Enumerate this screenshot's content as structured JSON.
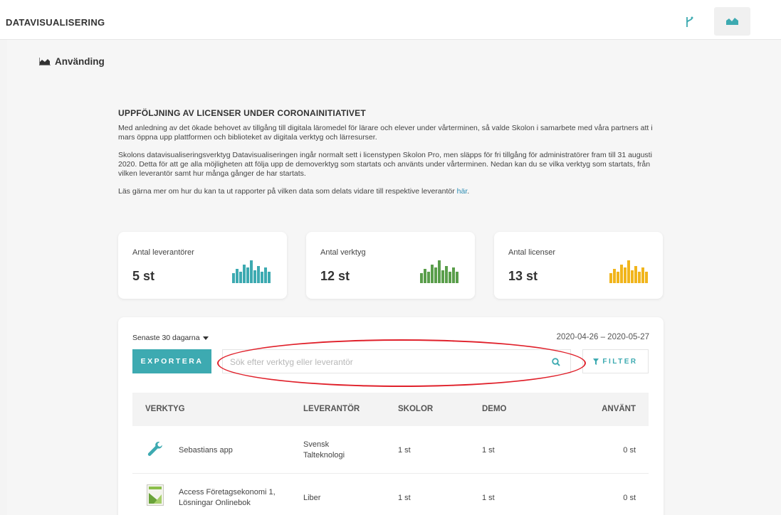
{
  "app": {
    "title": "DATAVISUALISERING"
  },
  "topbar": {
    "icons": [
      "branch-icon",
      "area-chart-icon"
    ]
  },
  "section": {
    "title": "Använding"
  },
  "intro": {
    "heading": "UPPFÖLJNING AV LICENSER UNDER CORONAINITIATIVET",
    "p1": "Med anledning av det ökade behovet av tillgång till digitala läromedel för lärare och elever under vårterminen, så valde Skolon i samarbete med våra partners att i mars öppna upp plattformen och biblioteket av digitala verktyg och lärresurser.",
    "p2": "Skolons datavisualiseringsverktyg Datavisualiseringen ingår normalt sett i licenstypen Skolon Pro, men släpps för fri tillgång för administratörer fram till 31 augusti 2020. Detta för att ge alla möjligheten att följa upp de demoverktyg som startats och använts under vårterminen. Nedan kan du se vilka verktyg som startats, från vilken leverantör samt hur många gånger de har startats.",
    "p3_prefix": "Läs gärna mer om hur du kan ta ut rapporter på vilken data som delats vidare till respektive leverantör ",
    "p3_link": "här",
    "p3_suffix": "."
  },
  "stats": [
    {
      "label": "Antal leverantörer",
      "value": "5 st",
      "color": "#3daab1"
    },
    {
      "label": "Antal verktyg",
      "value": "12 st",
      "color": "#5a9e4b"
    },
    {
      "label": "Antal licenser",
      "value": "13 st",
      "color": "#f1b51c"
    }
  ],
  "panel": {
    "range_label": "Senaste 30 dagarna",
    "date_range": "2020-04-26 – 2020-05-27",
    "export_label": "EXPORTERA",
    "search_placeholder": "Sök efter verktyg eller leverantör",
    "filter_label": "FILTER"
  },
  "table": {
    "columns": [
      "VERKTYG",
      "LEVERANTÖR",
      "SKOLOR",
      "DEMO",
      "ANVÄNT"
    ],
    "rows": [
      {
        "tool": "Sebastians app",
        "tool_line2": "",
        "vendor": "Svensk",
        "vendor_line2": "Talteknologi",
        "schools": "1 st",
        "demo": "1 st",
        "used": "0 st",
        "icon": "wrench-icon"
      },
      {
        "tool": "Access Företagsekonomi 1,",
        "tool_line2": "Lösningar Onlinebok",
        "vendor": "Liber",
        "vendor_line2": "",
        "schools": "1 st",
        "demo": "1 st",
        "used": "0 st",
        "icon": "book-cover-icon"
      }
    ]
  }
}
